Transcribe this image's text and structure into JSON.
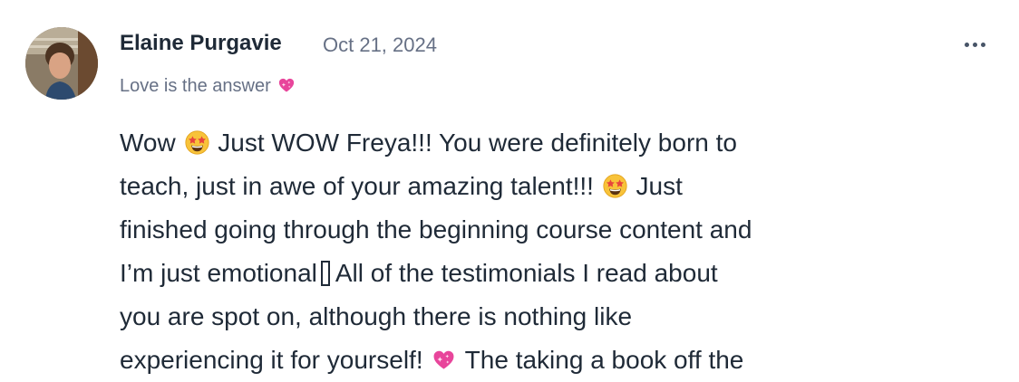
{
  "author": {
    "name": "Elaine Purgavie",
    "date": "Oct 21, 2024",
    "tagline": "Love is the answer",
    "tagline_emoji": "sparkling-heart-icon"
  },
  "menu": {
    "icon": "more-horizontal-icon"
  },
  "post": {
    "lines": [
      {
        "a": "Wow",
        "b": "Just WOW Freya!!! You were definitely born to"
      },
      {
        "a": "teach, just in awe of your amazing talent!!!",
        "b": "Just"
      },
      {
        "a": "finished going through the beginning course content and"
      },
      {
        "a": "I’m just emotional",
        "b": "All of the testimonials I read about"
      },
      {
        "a": "you are spot on, although there is nothing like"
      },
      {
        "a": "experiencing it for yourself!",
        "b": "The taking a book off the"
      }
    ],
    "emojis": {
      "star_struck": "star-struck-emoji-icon",
      "sparkling_heart": "sparkling-heart-icon",
      "missing_glyph": "missing-glyph-box"
    }
  },
  "colors": {
    "text": "#1f2a37",
    "muted": "#667085",
    "heart": "#e8459b",
    "star_face": "#f8c33a"
  }
}
